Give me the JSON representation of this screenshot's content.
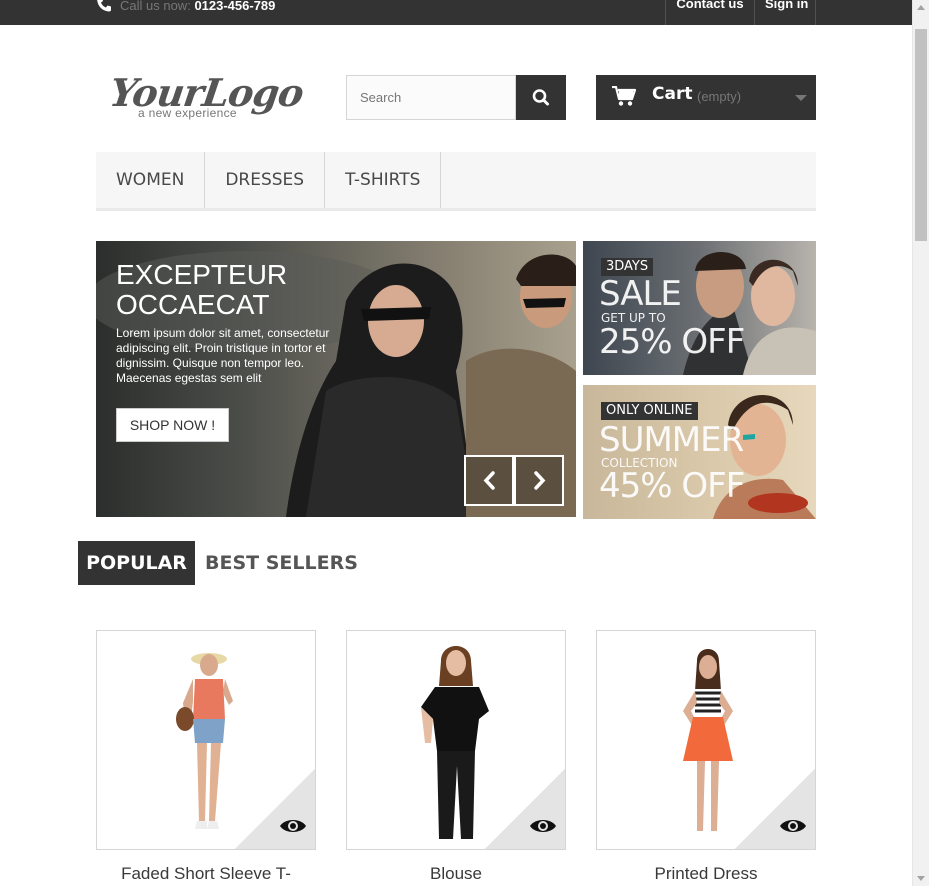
{
  "topbar": {
    "call_label": "Call us now:",
    "phone": "0123-456-789",
    "contact_label": "Contact us",
    "signin_label": "Sign in",
    "icons": [
      "phone-icon"
    ]
  },
  "header": {
    "logo_text": "YourLogo",
    "logo_tagline": "a new experience",
    "search_placeholder": "Search",
    "search_icon": "search-icon",
    "cart_label": "Cart",
    "cart_status": "(empty)",
    "cart_icon": "cart-icon"
  },
  "menu": {
    "items": [
      {
        "label": "WOMEN"
      },
      {
        "label": "DRESSES"
      },
      {
        "label": "T-SHIRTS"
      }
    ]
  },
  "slider": {
    "title": "EXCEPTEUR\nOCCAECAT",
    "text": "Lorem ipsum dolor sit amet, consectetur adipiscing elit. Proin tristique in tortor et dignissim. Quisque non tempor leo. Maecenas egestas sem elit",
    "button_label": "SHOP NOW !"
  },
  "banners": [
    {
      "tag": "3DAYS",
      "headline": "SALE",
      "subline": "GET UP TO",
      "offer": "25% OFF"
    },
    {
      "tag": "ONLY ONLINE",
      "headline": "SUMMER",
      "subline": "COLLECTION",
      "offer": "45% OFF"
    }
  ],
  "tabs": {
    "popular": "POPULAR",
    "best_sellers": "BEST SELLERS"
  },
  "products": [
    {
      "name": "Faded Short Sleeve T-"
    },
    {
      "name": "Blouse"
    },
    {
      "name": "Printed Dress"
    }
  ],
  "colors": {
    "dark": "#333333",
    "menu_bg": "#f6f6f6",
    "border": "#d6d4d4"
  }
}
